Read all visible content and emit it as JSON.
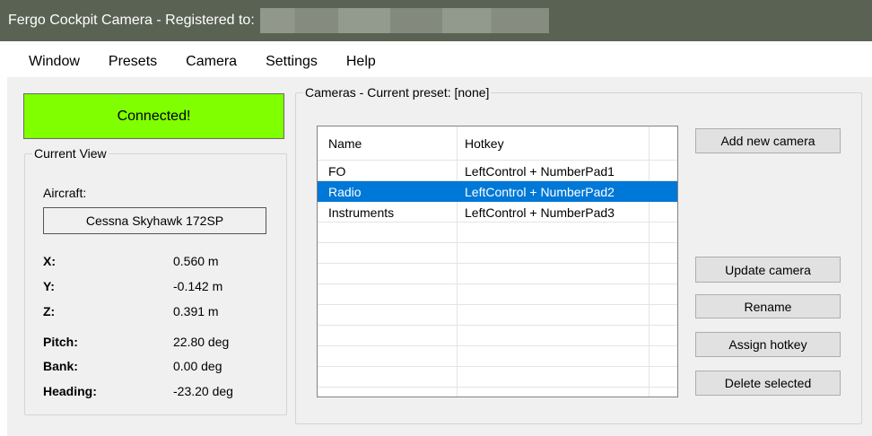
{
  "window": {
    "title": "Fergo Cockpit Camera - Registered to:",
    "registered_to": "████████████"
  },
  "menu": [
    "Window",
    "Presets",
    "Camera",
    "Settings",
    "Help"
  ],
  "status": {
    "text": "Connected!",
    "color": "#80ff00"
  },
  "current_view": {
    "legend": "Current View",
    "aircraft_label": "Aircraft:",
    "aircraft": "Cessna Skyhawk 172SP",
    "fields": [
      {
        "label": "X:",
        "value": "0.560 m"
      },
      {
        "label": "Y:",
        "value": "-0.142 m"
      },
      {
        "label": "Z:",
        "value": "0.391 m"
      },
      {
        "label": "Pitch:",
        "value": "22.80 deg"
      },
      {
        "label": "Bank:",
        "value": "0.00 deg"
      },
      {
        "label": "Heading:",
        "value": "-23.20 deg"
      }
    ]
  },
  "cameras": {
    "legend": "Cameras - Current preset: [none]",
    "columns": [
      "Name",
      "Hotkey"
    ],
    "rows": [
      {
        "name": "FO",
        "hotkey": "LeftControl + NumberPad1",
        "selected": false
      },
      {
        "name": "Radio",
        "hotkey": "LeftControl + NumberPad2",
        "selected": true
      },
      {
        "name": "Instruments",
        "hotkey": "LeftControl + NumberPad3",
        "selected": false
      }
    ],
    "buttons": {
      "add": "Add new camera",
      "update": "Update camera",
      "rename": "Rename",
      "assign": "Assign hotkey",
      "delete": "Delete selected"
    }
  },
  "colors": {
    "titlebar": "#5a6254",
    "selection": "#0078d7",
    "status_ok": "#80ff00"
  }
}
